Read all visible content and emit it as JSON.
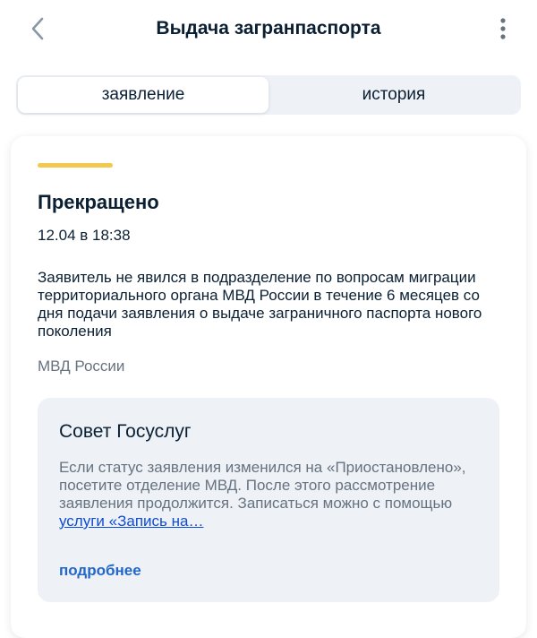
{
  "header": {
    "title": "Выдача загранпаспорта",
    "back_icon": "chevron-left-icon",
    "menu_icon": "more-vertical-icon"
  },
  "tabs": [
    {
      "label": "заявление",
      "active": true
    },
    {
      "label": "история",
      "active": false
    }
  ],
  "status": {
    "accent_color": "#f2c94c",
    "title": "Прекращено",
    "date": "12.04 в 18:38",
    "description": "Заявитель не явился в подразделение по вопросам миграции территориального органа МВД России в течение 6 месяцев со дня подачи заявления о выдаче заграничного паспорта нового поколения",
    "source": "МВД России"
  },
  "tip": {
    "title": "Совет Госуслуг",
    "text": "Если статус заявления изменился на «Приостановлено», посетите отделение МВД. После этого рассмотрение заявления продолжится. Записаться можно с помощью ",
    "link_text": "услуги «Запись на…",
    "more_label": "подробнее"
  }
}
